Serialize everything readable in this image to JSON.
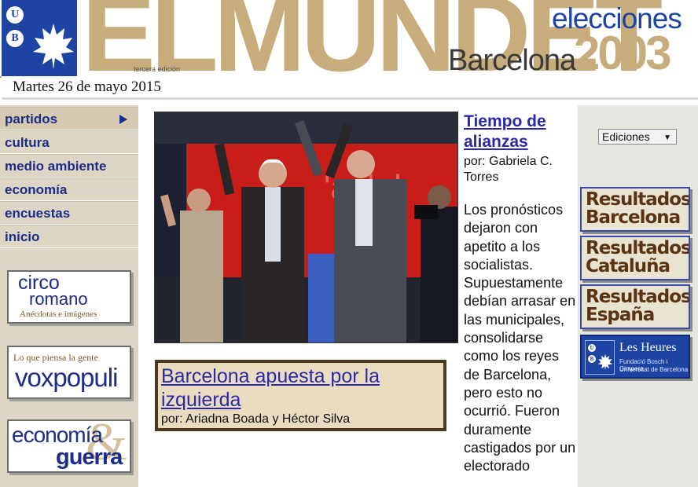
{
  "header": {
    "logo_u": "U",
    "logo_b": "B",
    "title": "ELMUNDET",
    "edition_note": "tercera edición",
    "elecciones": "elecciones",
    "city": "Barcelona",
    "year": "2003",
    "date": "Martes 26 de mayo 2015"
  },
  "sidebar": {
    "items": [
      {
        "label": "partidos",
        "has_arrow": true
      },
      {
        "label": "cultura"
      },
      {
        "label": "medio ambiente"
      },
      {
        "label": "economía"
      },
      {
        "label": "encuestas"
      },
      {
        "label": "inicio"
      }
    ],
    "promos": {
      "circo": {
        "line1": "circo",
        "line2": "romano",
        "line3": "Anécdotas e imágenes"
      },
      "vox": {
        "line1": "Lo que piensa la gente",
        "line2": "voxpopuli"
      },
      "economia": {
        "line1": "economía",
        "amp": "&",
        "line2": "guerra"
      }
    }
  },
  "lead": {
    "headline": "Barcelona apuesta por la izquierda",
    "byline": "por: Ariadna Boada y Héctor Silva"
  },
  "article": {
    "title": "Tiempo de alianzas",
    "byline": "por: Gabriela C. Torres",
    "body": "Los pronósticos dejaron con apetito a los socialistas. Supuestamente debían arrasar en las municipales, consolidarse como los reyes de Barcelona, pero esto no ocurrió. Fueron duramente castigados por un electorado"
  },
  "right": {
    "editions_select": "Ediciones",
    "results": [
      {
        "line1": "Resultados",
        "line2": "Barcelona"
      },
      {
        "line1": "Resultados",
        "line2": "Cataluña"
      },
      {
        "line1": "Resultados",
        "line2": "España"
      }
    ],
    "heures": {
      "name": "Les Heures",
      "sub1": "Fundació Bosch i Gimpera",
      "sub2": "Universitat de Barcelona",
      "logo_u": "U",
      "logo_b": "B"
    }
  },
  "colors": {
    "brand_blue": "#1d43a3",
    "gold": "#c7ac7c",
    "link": "#2a2aa8",
    "nav_text": "#1d2b8a",
    "sidebar_bg": "#ded6c4",
    "results_text": "#5a3412"
  },
  "icons": [
    "ub-leaf-logo-icon",
    "chevron-right-icon",
    "dropdown-caret-icon"
  ]
}
